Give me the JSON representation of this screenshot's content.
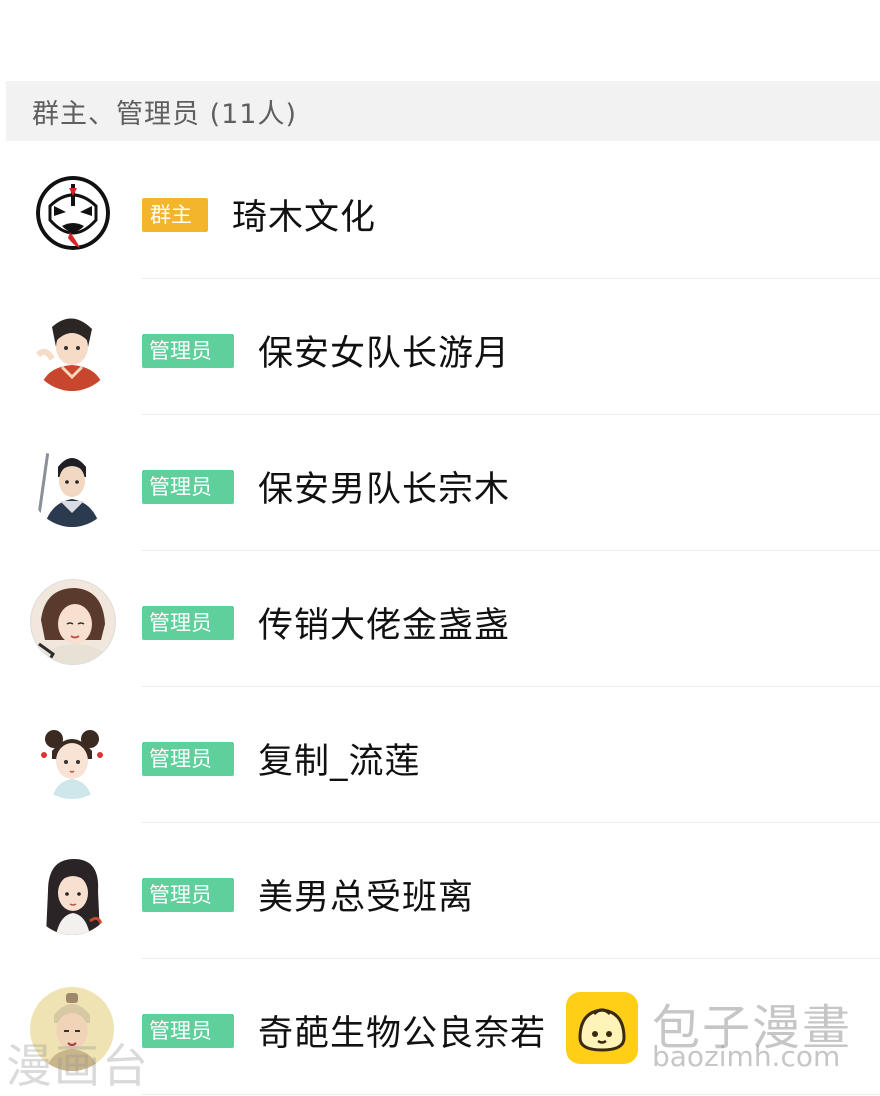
{
  "group": {
    "header": "群主、管理员 (11人)"
  },
  "members": [
    {
      "role": "群主",
      "name": "琦木文化",
      "avatar_icon": "opera-mask-avatar"
    },
    {
      "role": "管理员",
      "name": "保安女队长游月",
      "avatar_icon": "woman-avatar"
    },
    {
      "role": "管理员",
      "name": "保安男队长宗木",
      "avatar_icon": "man-sword-avatar"
    },
    {
      "role": "管理员",
      "name": "传销大佬金盏盏",
      "avatar_icon": "woman-avatar"
    },
    {
      "role": "管理员",
      "name": "复制_流莲",
      "avatar_icon": "girl-buns-avatar"
    },
    {
      "role": "管理员",
      "name": "美男总受班离",
      "avatar_icon": "long-hair-avatar"
    },
    {
      "role": "管理员",
      "name": "奇葩生物公良奈若",
      "avatar_icon": "elder-avatar"
    }
  ],
  "watermark": {
    "left": "漫画台",
    "title": "包子漫畫",
    "url": "baozimh.com"
  },
  "colors": {
    "owner_badge": "#f3b52b",
    "admin_badge": "#5fcf9c",
    "header_bg": "#f2f2f2"
  }
}
